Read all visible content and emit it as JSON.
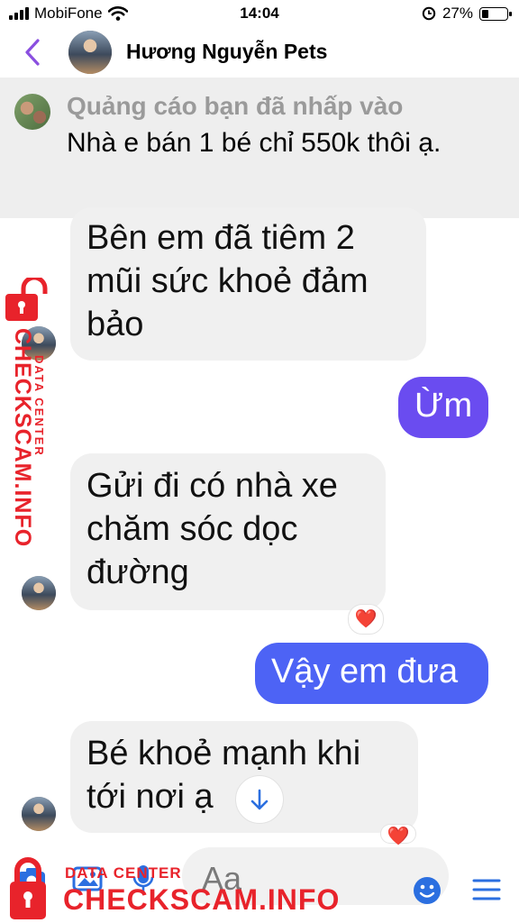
{
  "status_bar": {
    "carrier": "MobiFone",
    "time": "14:04",
    "battery_percent": "27%",
    "battery_level": 0.27
  },
  "header": {
    "contact_name": "Hương Nguyễn Pets",
    "accent_color": "#8a4fe0"
  },
  "ad": {
    "title": "Quảng cáo bạn đã nhấp vào",
    "text": "Nhà e bán 1 bé chỉ 550k thôi ạ."
  },
  "messages": [
    {
      "direction": "incoming",
      "text": "Bên em đã tiêm 2 mũi sức khoẻ đảm bảo"
    },
    {
      "direction": "outgoing",
      "text": "Ừm",
      "color": "#6a4cf0"
    },
    {
      "direction": "incoming",
      "text": "Gửi đi có nhà xe chăm sóc dọc đường",
      "reaction": "❤️"
    },
    {
      "direction": "outgoing",
      "text": "Vậy em đưa",
      "color": "#4d63f5"
    },
    {
      "direction": "incoming",
      "text": "Bé khoẻ mạnh khi tới nơi ạ",
      "reaction": "❤️"
    }
  ],
  "composer": {
    "placeholder": "Aa",
    "icon_color": "#2b6fe0"
  },
  "watermark": {
    "brand": "CHECKSCAM.INFO",
    "sub": "DATA CENTER",
    "color": "#e8232b"
  },
  "icons": [
    "back-chevron-icon",
    "camera-icon",
    "image-icon",
    "microphone-icon",
    "emoji-icon",
    "menu-icon",
    "scroll-down-icon",
    "heart-icon",
    "lock-icon",
    "wifi-icon",
    "alarm-icon"
  ]
}
